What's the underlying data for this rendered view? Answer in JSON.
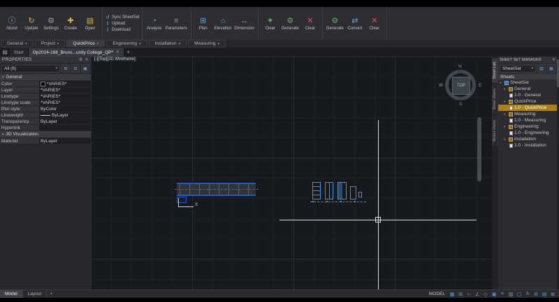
{
  "glyphs": {
    "caret": "▾",
    "close": "✕",
    "gear": "⚙",
    "menu": "▤",
    "plus": "+"
  },
  "ribbon": {
    "large": [
      {
        "label": "About",
        "glyph": "ⓘ"
      },
      {
        "label": "Update",
        "glyph": "↻"
      },
      {
        "label": "Settings",
        "glyph": "⚙"
      },
      {
        "label": "Create",
        "glyph": "✚"
      },
      {
        "label": "Open",
        "glyph": "▤"
      }
    ],
    "small": [
      {
        "label": "Sync SheetSet",
        "glyph": "↺"
      },
      {
        "label": "Upload",
        "glyph": "⇧"
      },
      {
        "label": "Download",
        "glyph": "⇩"
      }
    ],
    "tools": [
      {
        "label": "Analyze",
        "glyph": "◔"
      },
      {
        "label": "Parameters",
        "glyph": "≡"
      },
      {
        "label": "Plan",
        "glyph": "⊞"
      },
      {
        "label": "Elevation",
        "glyph": "⌂"
      },
      {
        "label": "Dimension",
        "glyph": "↔"
      },
      {
        "label": "Clear",
        "glyph": "✦"
      },
      {
        "label": "Generate",
        "glyph": "⚙"
      },
      {
        "label": "Clear",
        "glyph": "✕"
      },
      {
        "label": "Generate",
        "glyph": "⚙"
      },
      {
        "label": "Convert",
        "glyph": "⇄"
      },
      {
        "label": "Clear",
        "glyph": "✕"
      }
    ],
    "panels": [
      {
        "label": "General"
      },
      {
        "label": "Project"
      },
      {
        "label": "QuickPrice"
      },
      {
        "label": "Engineering"
      },
      {
        "label": "Installation"
      },
      {
        "label": "Measuring"
      }
    ]
  },
  "filetabs": {
    "tabs": [
      {
        "label": "Start"
      },
      {
        "label": "Op2024-188_Bruns...unity College_QP*"
      }
    ]
  },
  "properties": {
    "title": "PROPERTIES",
    "filter_value": "All (6)",
    "icons": [
      {
        "glyph": "⊞"
      },
      {
        "glyph": "⊟"
      },
      {
        "glyph": "▣"
      }
    ],
    "section_general": "General",
    "general": [
      {
        "label": "Color",
        "value": "*VARIES*"
      },
      {
        "label": "Layer",
        "value": "*VARIES*"
      },
      {
        "label": "Linetype",
        "value": "*VARIES*"
      },
      {
        "label": "Linetype scale",
        "value": "*VARIES*"
      },
      {
        "label": "Plot style",
        "value": "ByColor"
      },
      {
        "label": "Lineweight",
        "value": "ByLayer"
      },
      {
        "label": "Transparency",
        "value": "ByLayer"
      },
      {
        "label": "Hyperlink",
        "value": ""
      }
    ],
    "section_3d": "3D Visualization",
    "visualization": [
      {
        "label": "Material",
        "value": "ByLayer"
      }
    ]
  },
  "canvas": {
    "viewport_label": "[-][Top][2D Wireframe]",
    "viewcube": {
      "n": "N",
      "e": "E",
      "s": "S",
      "w": "W",
      "top": "TOP"
    },
    "ucs_label": "X"
  },
  "ssm": {
    "title": "SHEET SET MANAGER",
    "selector_value": "SheetSet",
    "icons": [
      {
        "glyph": "▥"
      },
      {
        "glyph": "▦"
      }
    ],
    "sheets_header": "Sheets",
    "tree": [
      {
        "label": "SheetSet"
      },
      {
        "label": "General"
      },
      {
        "label": "1.0 - General"
      },
      {
        "label": "QuickPrice"
      },
      {
        "label": "1.0 - QuickPrice"
      },
      {
        "label": "Measuring"
      },
      {
        "label": "1.0 - Measuring"
      },
      {
        "label": "Engineering"
      },
      {
        "label": "1.0 - Engineering"
      },
      {
        "label": "Installation"
      },
      {
        "label": "1.0 - Installation"
      }
    ],
    "side_tabs": [
      {
        "label": "Sheet List"
      },
      {
        "label": "Sheet Views"
      },
      {
        "label": "Model Views"
      }
    ]
  },
  "status": {
    "model_tab": "Model",
    "layout_tab": "Layout",
    "mode_label": "MODEL",
    "icons": [
      {
        "glyph": "▦"
      },
      {
        "glyph": "⊞"
      },
      {
        "glyph": "∟"
      },
      {
        "glyph": "∠"
      },
      {
        "glyph": "◇"
      },
      {
        "glyph": "▣"
      },
      {
        "glyph": "≡"
      },
      {
        "glyph": "▨"
      },
      {
        "glyph": "▢"
      },
      {
        "glyph": "A"
      },
      {
        "glyph": "⚙"
      },
      {
        "glyph": "▤"
      },
      {
        "glyph": "⊠"
      }
    ]
  },
  "colors": {
    "accent_blue": "#4f9edd",
    "selection_orange": "#a8801f",
    "canvas_bg": "#16191d",
    "cad_blue": "#2f93e8",
    "cad_red": "#cc3333",
    "crosshair": "#dcdcdc"
  }
}
